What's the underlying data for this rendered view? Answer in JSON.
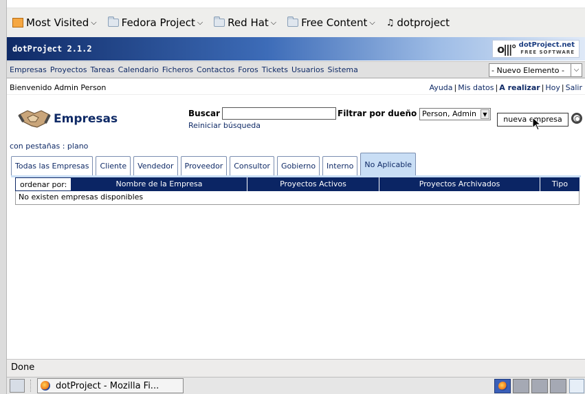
{
  "bookmarks": [
    {
      "label": "Most Visited",
      "icon": "most-visited-icon",
      "dropdown": true
    },
    {
      "label": "Fedora Project",
      "icon": "folder-icon",
      "dropdown": true
    },
    {
      "label": "Red Hat",
      "icon": "folder-icon",
      "dropdown": true
    },
    {
      "label": "Free Content",
      "icon": "folder-icon",
      "dropdown": true
    },
    {
      "label": "dotproject",
      "icon": "bookmark-icon",
      "dropdown": false
    }
  ],
  "app": {
    "version": "dotProject 2.1.2",
    "logo_name": "dotProject.net",
    "logo_sub": "FREE SOFTWARE"
  },
  "nav": {
    "items": [
      "Empresas",
      "Proyectos",
      "Tareas",
      "Calendario",
      "Ficheros",
      "Contactos",
      "Foros",
      "Tickets",
      "Usuarios",
      "Sistema"
    ],
    "new_element": "- Nuevo Elemento -"
  },
  "welcome": {
    "text": "Bienvenido Admin Person",
    "help": "Ayuda",
    "my_data": "Mis datos",
    "todo": "A realizar",
    "today": "Hoy",
    "logout": "Salir"
  },
  "page": {
    "title": "Empresas",
    "search_label": "Buscar",
    "search_value": "",
    "reset_search": "Reiniciar búsqueda",
    "owner_label": "Filtrar por dueño",
    "owner_value": "Person, Admin",
    "new_company": "nueva empresa",
    "tabs_mode": "con pestañas : plano"
  },
  "tabs": [
    {
      "label": "Todas las Empresas",
      "active": false
    },
    {
      "label": "Cliente",
      "active": false
    },
    {
      "label": "Vendedor",
      "active": false
    },
    {
      "label": "Proveedor",
      "active": false
    },
    {
      "label": "Consultor",
      "active": false
    },
    {
      "label": "Gobierno",
      "active": false
    },
    {
      "label": "Interno",
      "active": false
    },
    {
      "label": "No Aplicable",
      "active": true
    }
  ],
  "table": {
    "sort_label": "ordenar por:",
    "columns": [
      "Nombre de la Empresa",
      "Proyectos Activos",
      "Proyectos Archivados",
      "Tipo"
    ],
    "empty_message": "No existen empresas disponibles"
  },
  "status": {
    "text": "Done"
  },
  "taskbar": {
    "window_label": "dotProject - Mozilla Fi..."
  },
  "colors": {
    "header_dark": "#0f2a66",
    "table_header": "#0b2564",
    "active_tab": "#c9def5"
  }
}
